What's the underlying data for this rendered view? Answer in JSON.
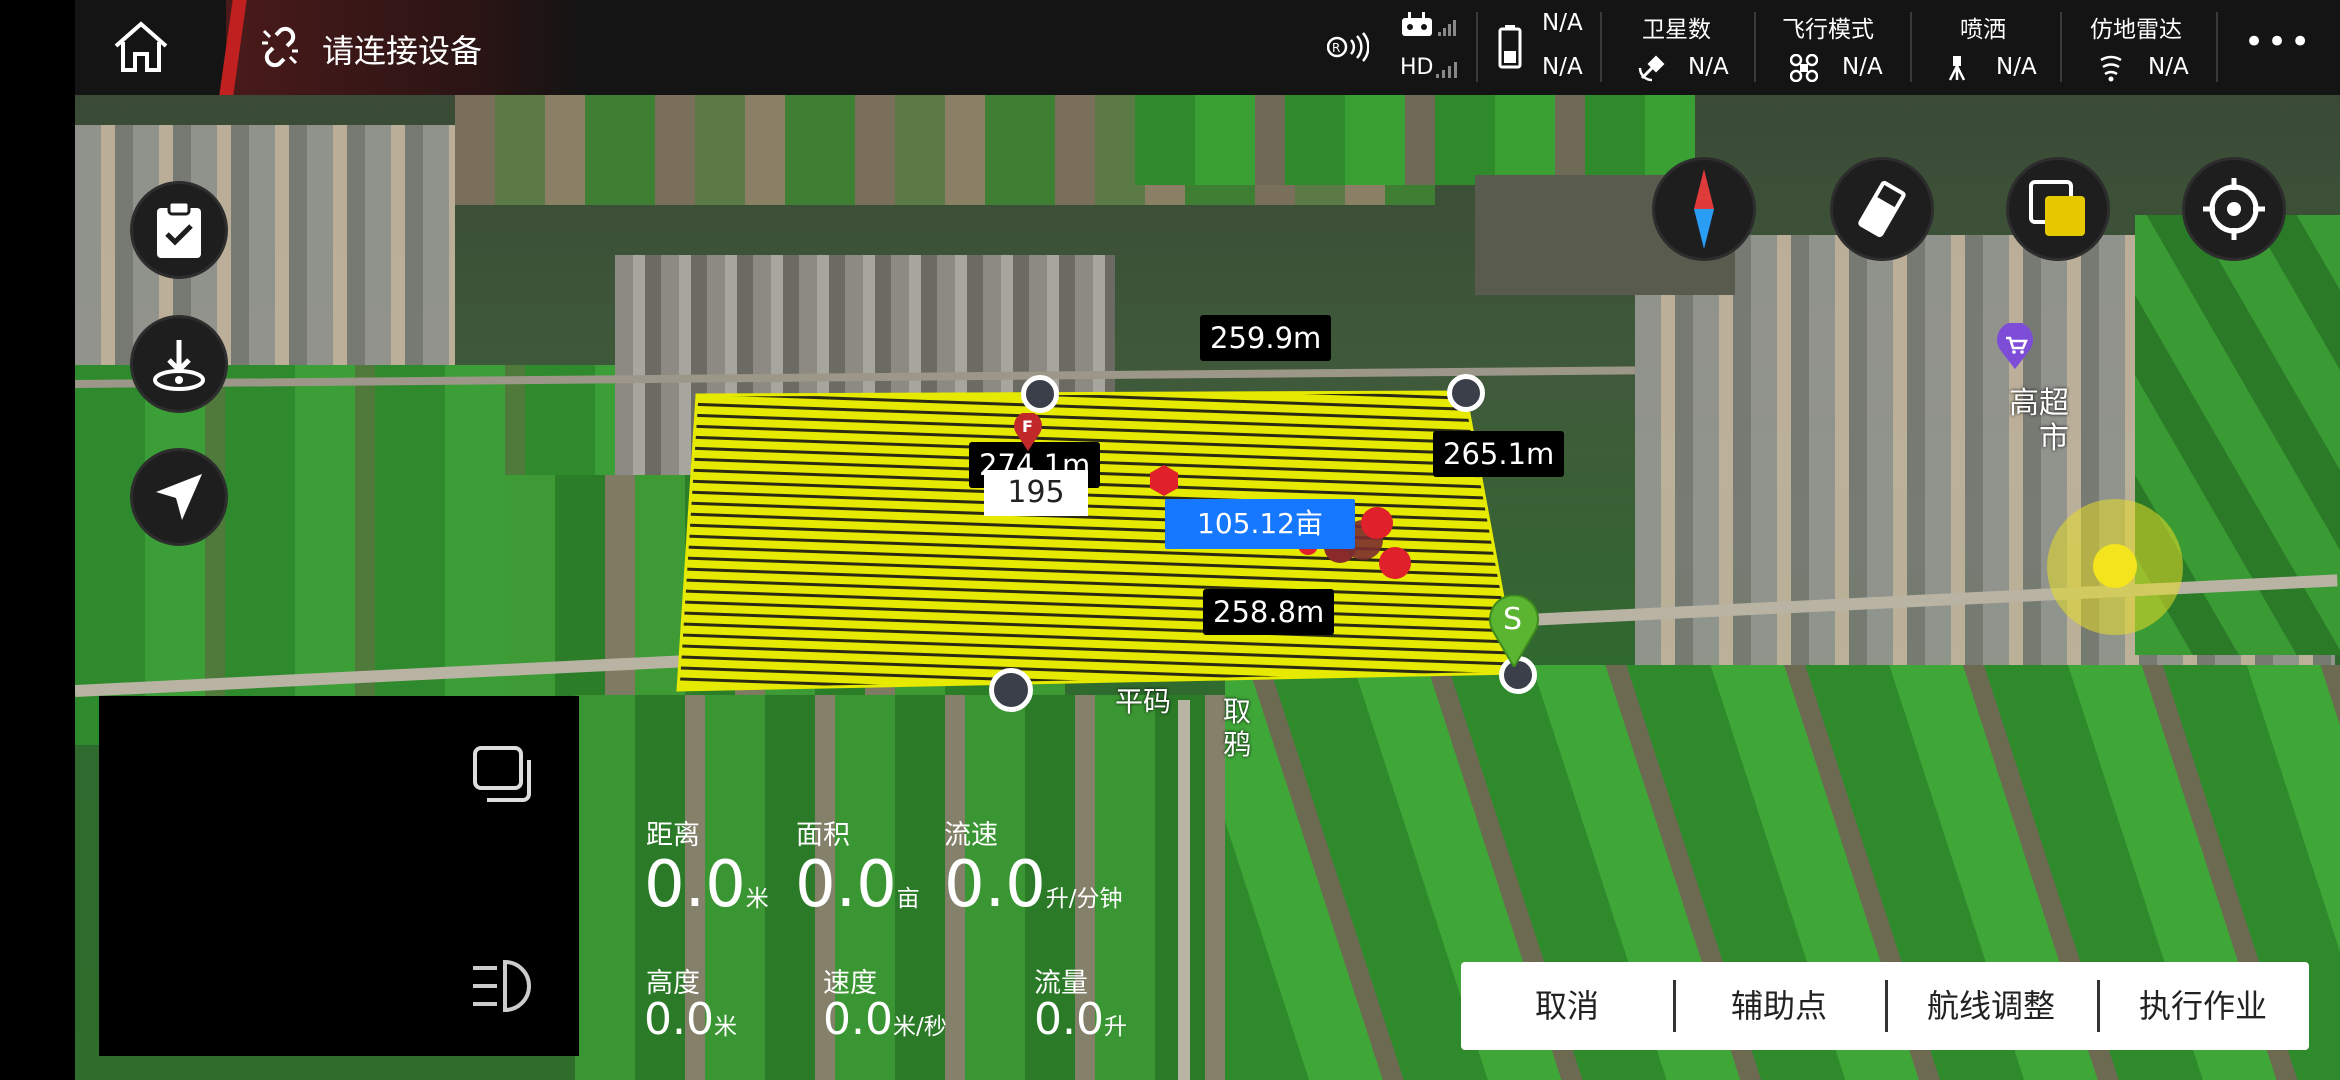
{
  "topbar": {
    "connection_status": "请连接设备",
    "rc_signal_hd": "HD",
    "signal_value_1": "N/A",
    "battery_value": "N/A",
    "satellites": {
      "label": "卫星数",
      "value": "N/A"
    },
    "flight_mode": {
      "label": "飞行模式",
      "value": "N/A"
    },
    "spray": {
      "label": "喷洒",
      "value": "N/A"
    },
    "terrain_radar": {
      "label": "仿地雷达",
      "value": "N/A"
    },
    "more": "•••"
  },
  "map": {
    "edges": {
      "top": "259.9m",
      "right": "265.1m",
      "bottom": "258.8m",
      "left_obscured": "274.1m"
    },
    "point_count_label": "195",
    "area_label": "105.12亩",
    "start_marker": "S",
    "finish_marker": "F",
    "village_label_1": "高超",
    "village_label_2": "市",
    "road_label_1": "平码",
    "road_label_2": "取",
    "road_label_3": "鸦",
    "colors": {
      "field_fill": "#e8e800",
      "area_badge": "#1677ff",
      "start_marker": "#5cb531",
      "finish_marker": "#c0282a"
    }
  },
  "stats": {
    "distance": {
      "label": "距离",
      "value": "0.0",
      "unit": "米"
    },
    "area": {
      "label": "面积",
      "value": "0.0",
      "unit": "亩"
    },
    "flow_rate": {
      "label": "流速",
      "value": "0.0",
      "unit": "升/分钟"
    },
    "height": {
      "label": "高度",
      "value": "0.0",
      "unit": "米"
    },
    "speed": {
      "label": "速度",
      "value": "0.0",
      "unit": "米/秒"
    },
    "flow_volume": {
      "label": "流量",
      "value": "0.0",
      "unit": "升"
    }
  },
  "actions": {
    "cancel": "取消",
    "aux_point": "辅助点",
    "route_adjust": "航线调整",
    "execute": "执行作业"
  }
}
